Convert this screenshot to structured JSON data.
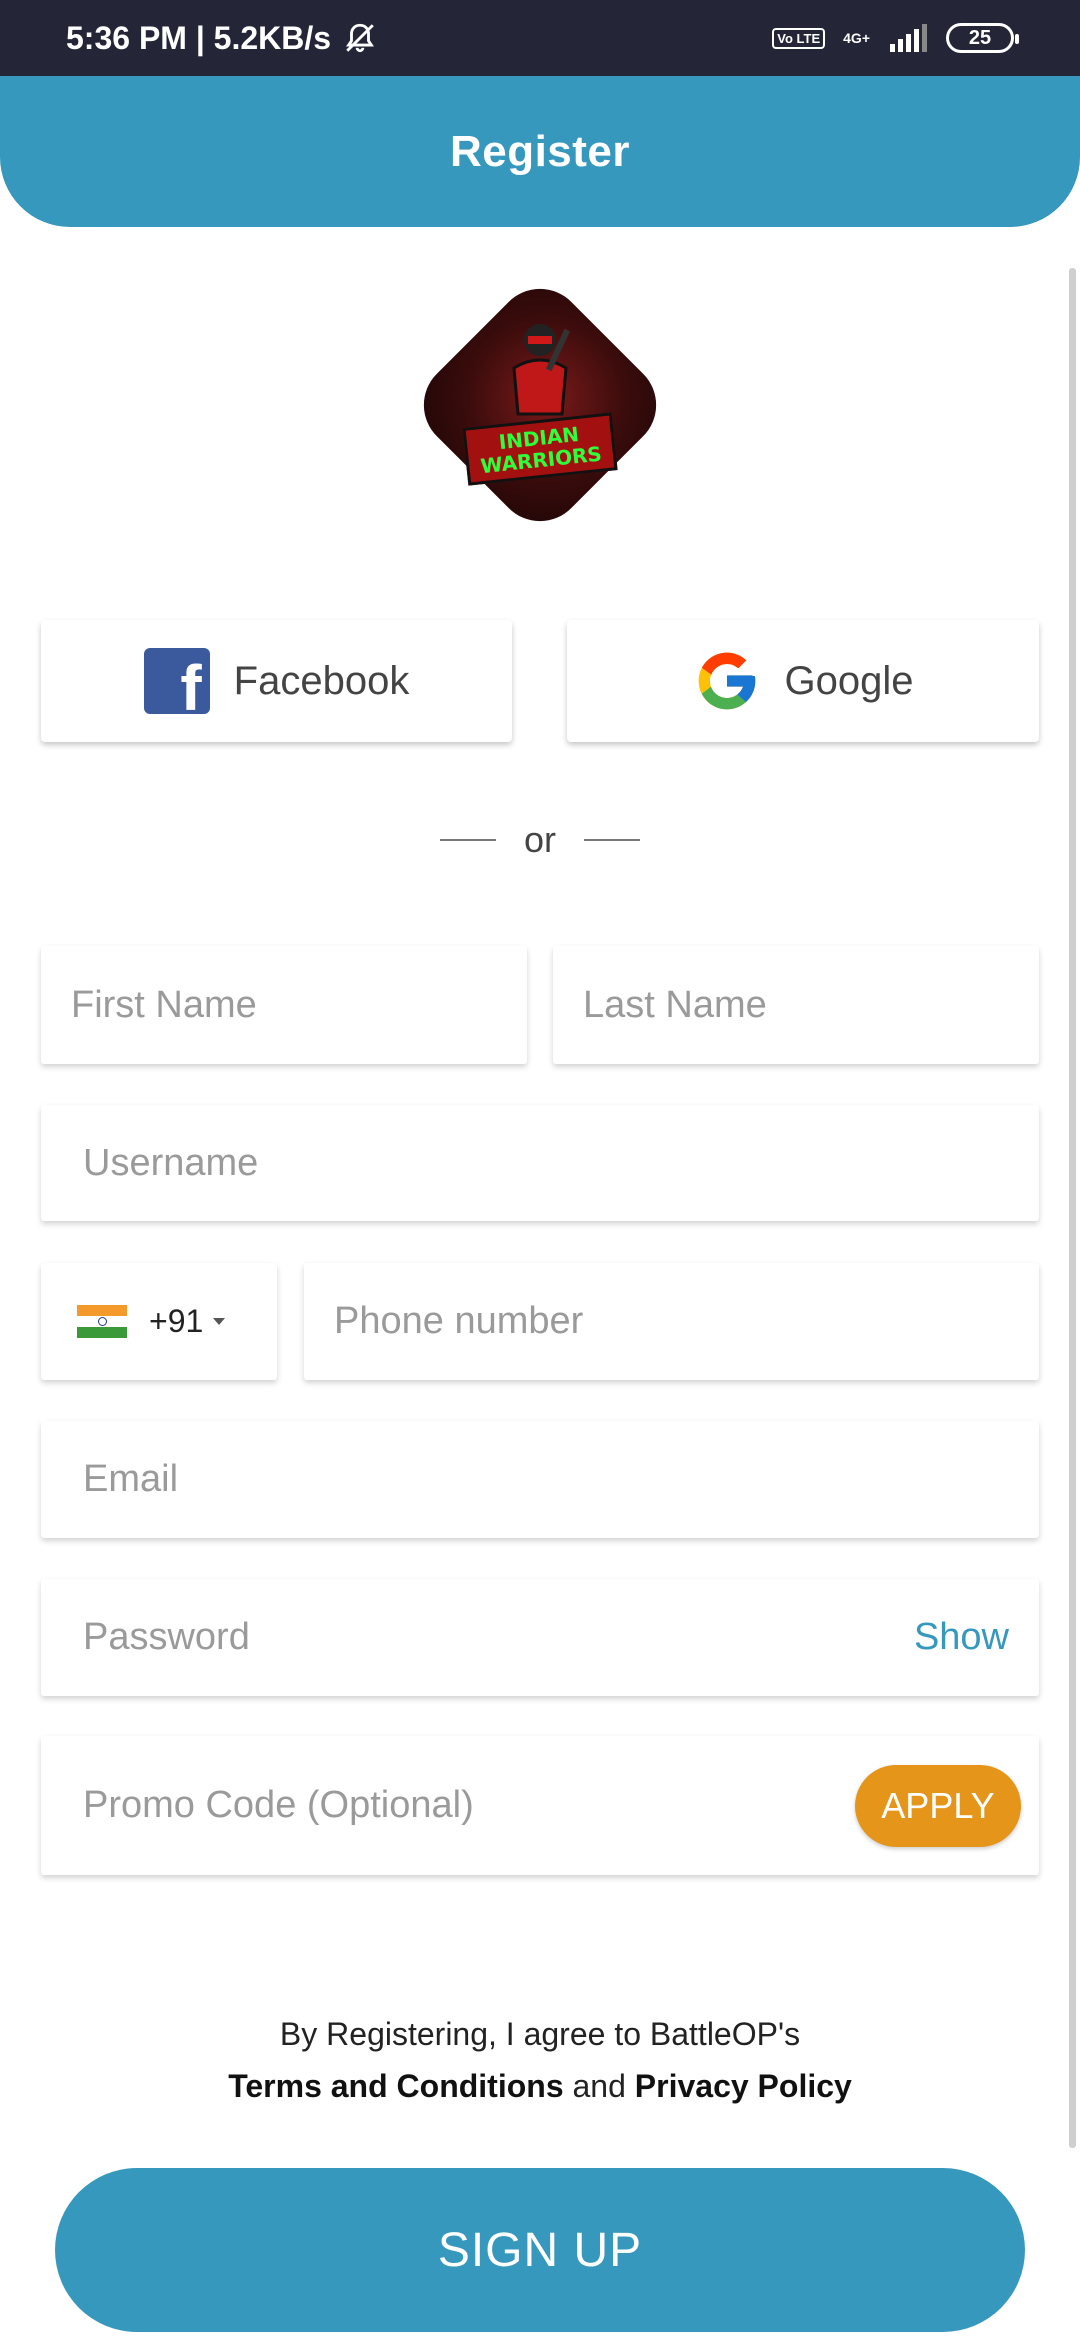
{
  "status_bar": {
    "time_speed": "5:36 PM | 5.2KB/s",
    "network_badge": "Vo LTE",
    "network_type": "4G+",
    "battery": "25"
  },
  "header": {
    "title": "Register"
  },
  "logo": {
    "text_line1": "INDIAN",
    "text_line2": "WARRIORS"
  },
  "social": {
    "facebook_label": "Facebook",
    "google_label": "Google"
  },
  "divider": {
    "label": "or"
  },
  "form": {
    "first_name_placeholder": "First Name",
    "last_name_placeholder": "Last Name",
    "username_placeholder": "Username",
    "country_code": "+91",
    "phone_placeholder": "Phone number",
    "email_placeholder": "Email",
    "password_placeholder": "Password",
    "show_label": "Show",
    "promo_placeholder": "Promo Code (Optional)",
    "apply_label": "APPLY"
  },
  "terms": {
    "line1": "By Registering, I agree to BattleOP's",
    "terms_link": "Terms and Conditions",
    "and": "and",
    "privacy_link": "Privacy Policy"
  },
  "signup": {
    "label": "SIGN UP"
  },
  "colors": {
    "primary": "#3798bd",
    "accent": "#e5961a",
    "status_bar": "#242638"
  }
}
